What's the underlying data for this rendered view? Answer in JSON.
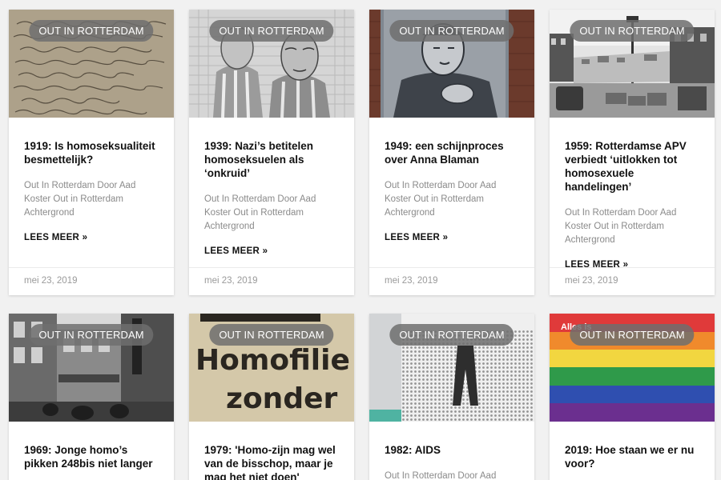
{
  "badge_label": "OUT IN ROTTERDAM",
  "read_more_label": "LEES MEER »",
  "cards_row1": [
    {
      "title": "1919: Is homoseksualiteit besmettelijk?",
      "meta": "Out In Rotterdam Door Aad Koster Out in Rotterdam Achtergrond",
      "date": "mei 23, 2019",
      "image": "handwritten-letter-image"
    },
    {
      "title": "1939: Nazi’s betitelen homoseksuelen als ‘onkruid’",
      "meta": "Out In Rotterdam Door Aad Koster Out in Rotterdam Achtergrond",
      "date": "mei 23, 2019",
      "image": "prisoners-drawing-image"
    },
    {
      "title": "1949: een schijnproces over Anna Blaman",
      "meta": "Out In Rotterdam Door Aad Koster Out in Rotterdam Achtergrond",
      "date": "mei 23, 2019",
      "image": "wall-mural-image"
    },
    {
      "title": "1959: Rotterdamse APV verbiedt ‘uitlokken tot homosexuele handelingen’",
      "meta": "Out In Rotterdam Door Aad Koster Out in Rotterdam Achtergrond",
      "date": "mei 23, 2019",
      "image": "harbour-photo-image"
    }
  ],
  "cards_row2": [
    {
      "title": "1969: Jonge homo’s pikken 248bis niet langer",
      "meta": "",
      "image": "street-photo-image"
    },
    {
      "title": "1979: 'Homo-zijn mag wel van de bisschop, maar je mag het niet doen'",
      "meta": "",
      "image": "newspaper-headline-image",
      "image_text_1": "Homofilie",
      "image_text_2": "zonder"
    },
    {
      "title": "1982: AIDS",
      "meta": "Out In Rotterdam Door Aad",
      "image": "poster-image"
    },
    {
      "title": "2019: Hoe staan we er nu voor?",
      "meta": "",
      "image": "rainbow-flag-image",
      "image_text_1": "Alles is"
    }
  ]
}
